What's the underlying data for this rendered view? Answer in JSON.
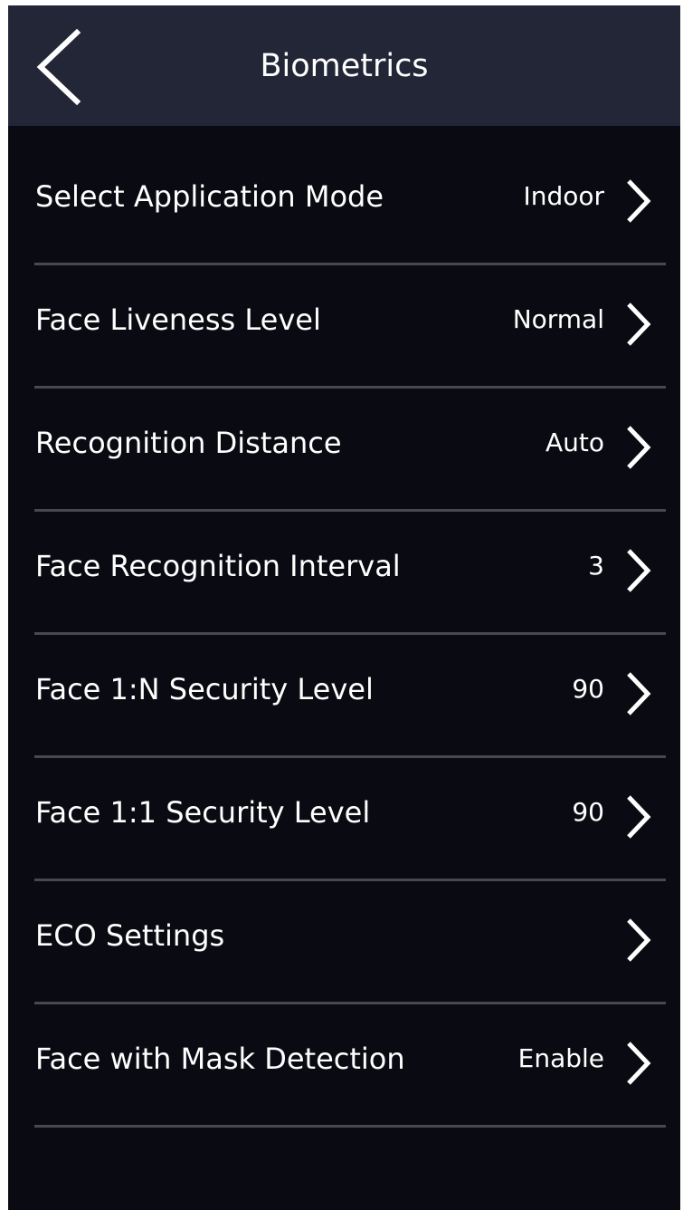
{
  "header": {
    "title": "Biometrics"
  },
  "colors": {
    "header_bg": "#232637",
    "screen_bg": "#0a0b12",
    "text": "#ffffff",
    "divider": "#474850"
  },
  "settings": {
    "items": [
      {
        "label": "Select Application Mode",
        "value": "Indoor"
      },
      {
        "label": "Face Liveness Level",
        "value": "Normal"
      },
      {
        "label": "Recognition Distance",
        "value": "Auto"
      },
      {
        "label": "Face Recognition Interval",
        "value": "3"
      },
      {
        "label": "Face 1:N Security Level",
        "value": "90"
      },
      {
        "label": "Face 1:1 Security Level",
        "value": "90"
      },
      {
        "label": "ECO Settings",
        "value": ""
      },
      {
        "label": "Face with Mask Detection",
        "value": "Enable"
      }
    ]
  },
  "icons": {
    "back": "chevron-left-icon",
    "row_arrow": "chevron-right-icon"
  }
}
